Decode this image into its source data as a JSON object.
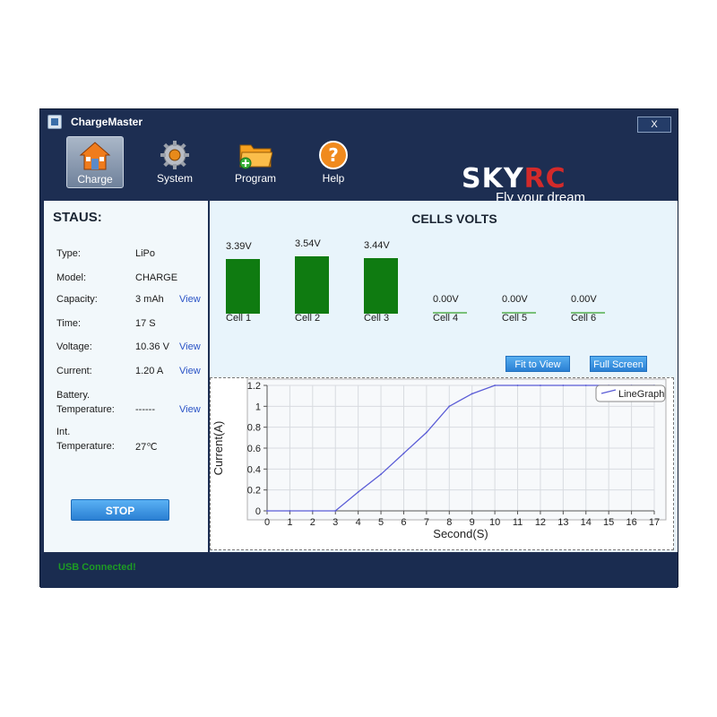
{
  "app": {
    "title": "ChargeMaster",
    "close_label": "X"
  },
  "toolbar": {
    "items": [
      {
        "label": "Charge",
        "icon": "house-icon",
        "active": true
      },
      {
        "label": "System",
        "icon": "gear-icon"
      },
      {
        "label": "Program",
        "icon": "folder-icon"
      },
      {
        "label": "Help",
        "icon": "help-icon"
      }
    ]
  },
  "brand": {
    "logo_sky": "SKY",
    "logo_rc": "RC",
    "tagline": "Fly your dream"
  },
  "status": {
    "title": "STAUS:",
    "rows": [
      {
        "key": "Type:",
        "value": "LiPo"
      },
      {
        "key": "Model:",
        "value": "CHARGE"
      },
      {
        "key": "Capacity:",
        "value": "3 mAh",
        "link": "View"
      },
      {
        "key": "Time:",
        "value": "17 S"
      },
      {
        "key": "Voltage:",
        "value": "10.36 V",
        "link": "View"
      },
      {
        "key": "Current:",
        "value": "1.20 A",
        "link": "View"
      },
      {
        "key_line1": "Battery.",
        "key_line2": "Temperature:",
        "value": "------",
        "link": "View"
      },
      {
        "key_line1": "Int.",
        "key_line2": "Temperature:",
        "value": "27℃"
      }
    ],
    "stop_label": "STOP"
  },
  "cells": {
    "title": "CELLS VOLTS",
    "items": [
      {
        "name": "Cell 1",
        "voltage": "3.39V",
        "value": 3.39
      },
      {
        "name": "Cell 2",
        "voltage": "3.54V",
        "value": 3.54
      },
      {
        "name": "Cell 3",
        "voltage": "3.44V",
        "value": 3.44
      },
      {
        "name": "Cell 4",
        "voltage": "0.00V",
        "value": 0.0
      },
      {
        "name": "Cell 5",
        "voltage": "0.00V",
        "value": 0.0
      },
      {
        "name": "Cell 6",
        "voltage": "0.00V",
        "value": 0.0
      }
    ],
    "bar_color": "#0f7b11"
  },
  "buttons": {
    "fit_to_view": "Fit to View",
    "full_screen": "Full Screen"
  },
  "footer": {
    "status": "USB  Connected!"
  },
  "chart_data": {
    "type": "line",
    "xlabel": "Second(S)",
    "ylabel": "Current(A)",
    "xlim": [
      0,
      17
    ],
    "ylim": [
      0,
      1.2
    ],
    "xticks": [
      0,
      1,
      2,
      3,
      4,
      5,
      6,
      7,
      8,
      9,
      10,
      11,
      12,
      13,
      14,
      15,
      16,
      17
    ],
    "yticks": [
      0,
      0.2,
      0.4,
      0.6,
      0.8,
      1,
      1.2
    ],
    "grid": true,
    "legend": "top-right",
    "series": [
      {
        "name": "LineGraph",
        "color": "#5a5cd6",
        "x": [
          0,
          1,
          2,
          3,
          4,
          5,
          6,
          7,
          8,
          9,
          10,
          11,
          12,
          13,
          14,
          15,
          16,
          17
        ],
        "y": [
          0,
          0,
          0,
          0,
          0.18,
          0.35,
          0.55,
          0.75,
          1.0,
          1.12,
          1.2,
          1.2,
          1.2,
          1.2,
          1.2,
          1.2,
          1.2,
          1.2
        ]
      }
    ]
  }
}
